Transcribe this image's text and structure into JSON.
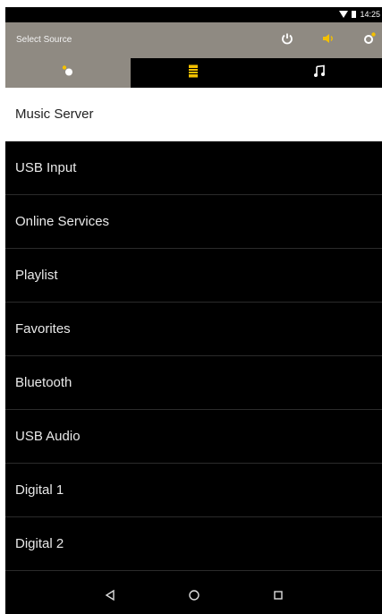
{
  "status": {
    "time": "14:25"
  },
  "header": {
    "title": "Select Source",
    "actions": [
      "power-icon",
      "volume-icon",
      "settings-icon"
    ]
  },
  "tabs": [
    {
      "icon": "source-icon",
      "active": true
    },
    {
      "icon": "library-icon",
      "active": false
    },
    {
      "icon": "music-note-icon",
      "active": false
    }
  ],
  "sources": [
    {
      "label": "Music Server",
      "selected": true
    },
    {
      "label": "USB Input"
    },
    {
      "label": "Online Services"
    },
    {
      "label": "Playlist"
    },
    {
      "label": "Favorites"
    },
    {
      "label": "Bluetooth"
    },
    {
      "label": "USB Audio"
    },
    {
      "label": "Digital 1"
    },
    {
      "label": "Digital 2"
    }
  ],
  "colors": {
    "appbar": "#8f8a82",
    "accent": "#f3c000"
  },
  "nav": [
    "back-icon",
    "home-icon",
    "recents-icon"
  ]
}
